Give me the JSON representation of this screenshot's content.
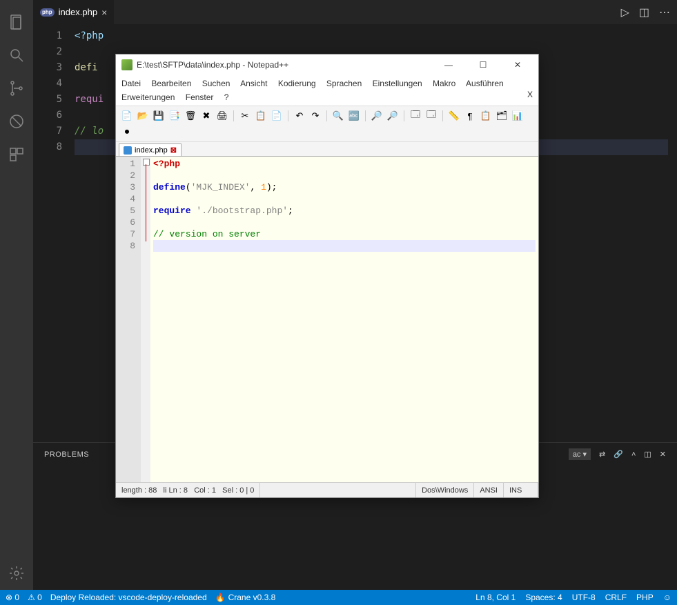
{
  "vscode": {
    "tab": {
      "label": "index.php"
    },
    "tab_actions": {
      "run": "▷",
      "split": "◫",
      "more": "⋯"
    },
    "lines": [
      "1",
      "2",
      "3",
      "4",
      "5",
      "6",
      "7",
      "8"
    ],
    "code": {
      "l1_tag": "<?php",
      "l3_define": "defi",
      "l5_require": "requi",
      "l7_comment": "// lo",
      "l8": ""
    },
    "panel": {
      "title": "PROBLEMS",
      "dropdown": "ac ▾"
    },
    "status": {
      "err": "⊗ 0",
      "warn": "⚠ 0",
      "deploy": "Deploy Reloaded: vscode-deploy-reloaded",
      "crane_icon": "🔥",
      "crane": "Crane v0.3.8",
      "pos": "Ln 8, Col 1",
      "spaces": "Spaces: 4",
      "enc": "UTF-8",
      "eol": "CRLF",
      "lang": "PHP",
      "smile": "☺"
    }
  },
  "npp": {
    "title": "E:\\test\\SFTP\\data\\index.php - Notepad++",
    "winbtns": {
      "min": "—",
      "max": "☐",
      "close": "✕"
    },
    "menu1": [
      "Datei",
      "Bearbeiten",
      "Suchen",
      "Ansicht",
      "Kodierung",
      "Sprachen",
      "Einstellungen",
      "Makro",
      "Ausführen"
    ],
    "menu2": [
      "Erweiterungen",
      "Fenster",
      "?"
    ],
    "menu_close": "X",
    "tab": {
      "label": "index.php"
    },
    "lines": [
      "1",
      "2",
      "3",
      "4",
      "5",
      "6",
      "7",
      "8"
    ],
    "code": {
      "l1": "<?php",
      "l3_define": "define",
      "l3_paren1": "(",
      "l3_str": "'MJK_INDEX'",
      "l3_comma": ", ",
      "l3_num": "1",
      "l3_paren2": ");",
      "l5_require": "require",
      "l5_sp": " ",
      "l5_str": "'./bootstrap.php'",
      "l5_semi": ";",
      "l7_comment": "// version on server"
    },
    "status": {
      "length": "length : 88",
      "lines": "li  Ln : 8",
      "col": "Col : 1",
      "sel": "Sel : 0 | 0",
      "eol": "Dos\\Windows",
      "enc": "ANSI",
      "mode": "INS"
    },
    "toolbar_icons": [
      "📄",
      "📂",
      "💾",
      "📑",
      "🗑",
      "✖",
      "🖨",
      "✂",
      "📋",
      "📄",
      "📋",
      "↶",
      "↷",
      "🔍",
      "🔤",
      "🔎",
      "🔎",
      "🗔",
      "🗔",
      "📏",
      "¶",
      "📋",
      "🗂",
      "📊",
      "⏺"
    ]
  }
}
